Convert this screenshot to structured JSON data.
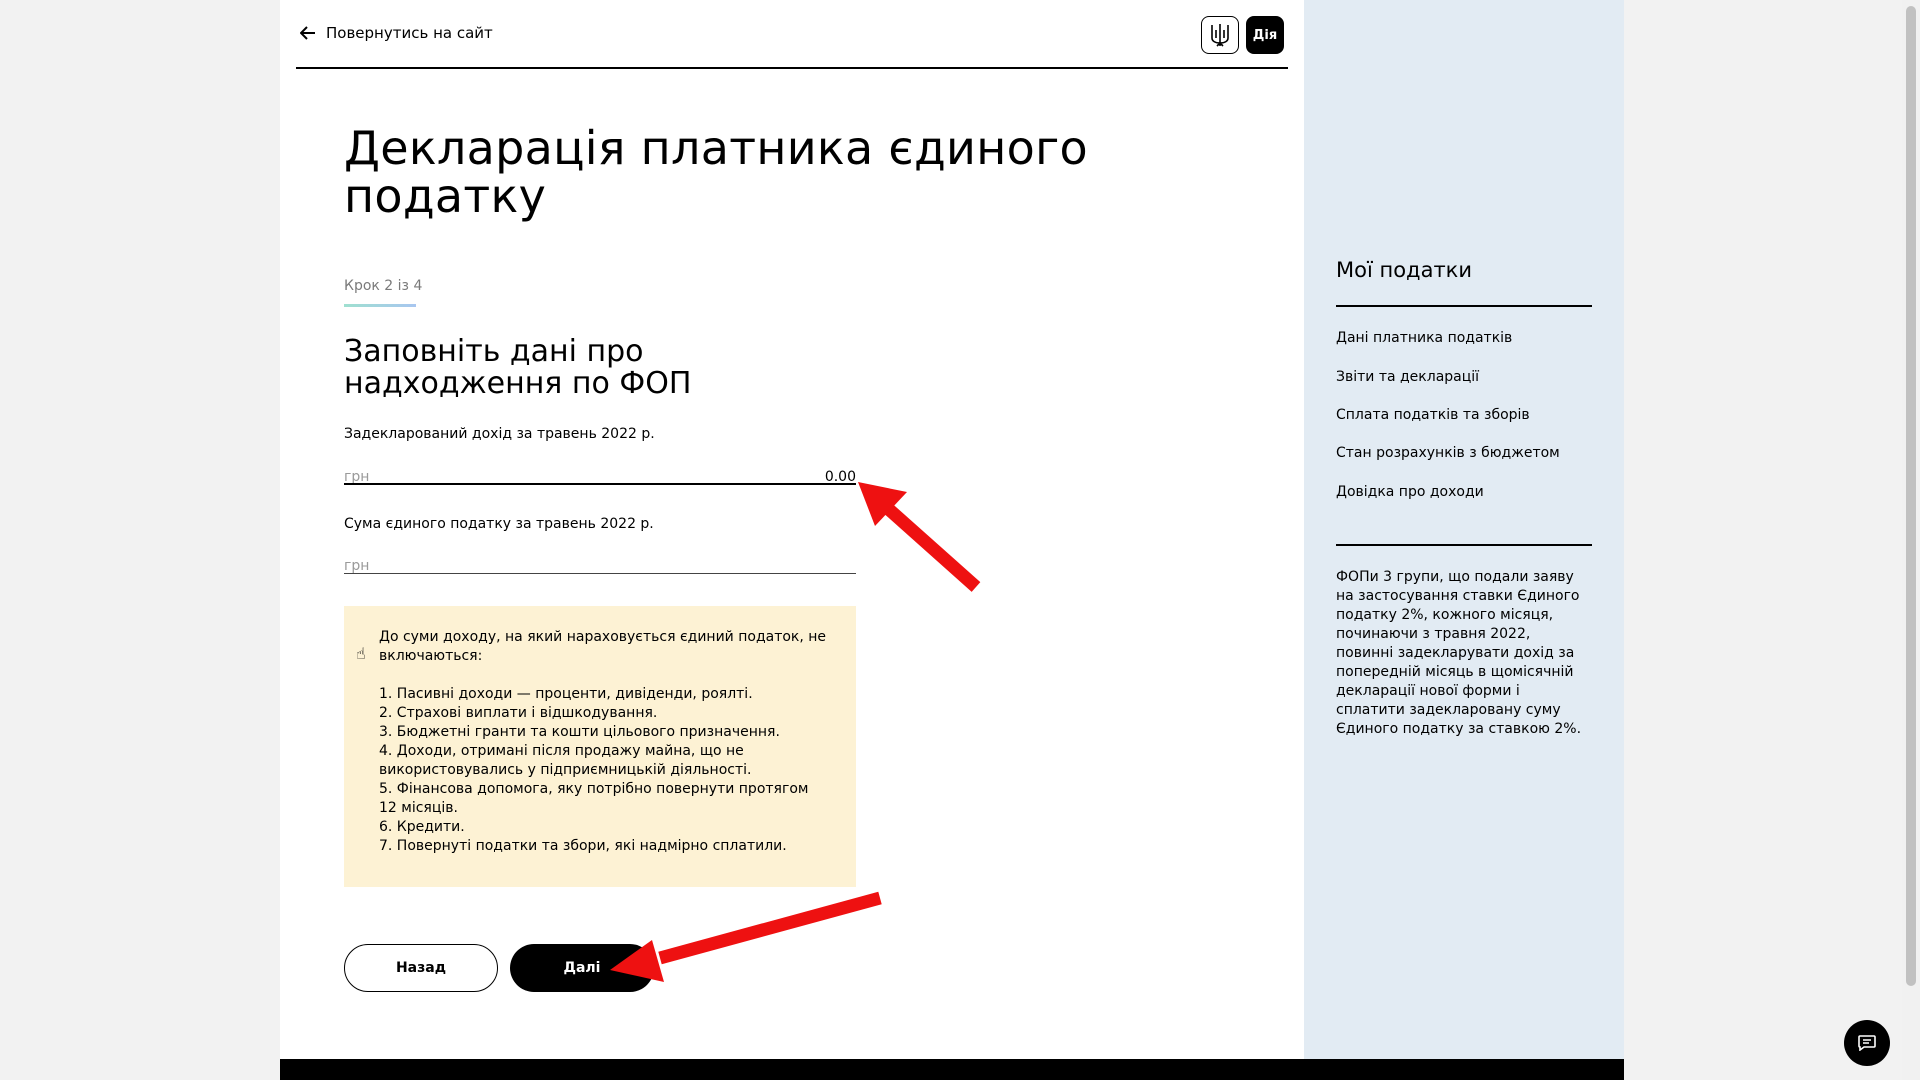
{
  "header": {
    "back_label": "Повернутись на сайт",
    "logo_diia": "Дія"
  },
  "main": {
    "title": "Декларація платника єдиного податку",
    "step": "Крок 2 із 4",
    "subtitle": "Заповніть дані про надходження по ФОП",
    "fields": [
      {
        "label": "Задекларований дохід за травень 2022 р.",
        "unit": "грн",
        "value": "0.00"
      },
      {
        "label": "Сума єдиного податку за травень 2022 р.",
        "unit": "грн",
        "value": ""
      }
    ],
    "info": {
      "intro": "До суми доходу, на який нараховується єдиний податок, не включаються:",
      "items": [
        "1. Пасивні доходи — проценти, дивіденди, роялті.",
        "2. Страхові виплати і відшкодування.",
        "3. Бюджетні гранти та кошти цільового призначення.",
        "4. Доходи, отримані після продажу майна, що не використовувались у підприємницькій діяльності.",
        "5. Фінансова допомога, яку потрібно повернути протягом 12 місяців.",
        "6. Кредити.",
        "7. Повернуті податки та збори, які надмірно сплатили."
      ]
    },
    "buttons": {
      "back": "Назад",
      "next": "Далі"
    }
  },
  "sidebar": {
    "title": "Мої податки",
    "links": [
      "Дані платника податків",
      "Звіти та декларації",
      "Сплата податків та зборів",
      "Стан розрахунків з бюджетом",
      "Довідка про доходи"
    ],
    "note": "ФОПи 3 групи, що подали заяву на застосування ставки Єдиного податку 2%, кожного місяця, починаючи з травня 2022, повинні задекларувати дохід за попередній місяць в щомісячній декларації нової форми і сплатити задекларовану суму Єдиного податку за ставкою 2%."
  },
  "colors": {
    "arrow": "#ee1111",
    "info_bg": "#fdf2d4",
    "sidebar_bg": "#e2ebf3"
  },
  "icons": [
    "arrow-left-icon",
    "trident-logo-icon",
    "pointing-hand-icon",
    "chat-icon"
  ]
}
